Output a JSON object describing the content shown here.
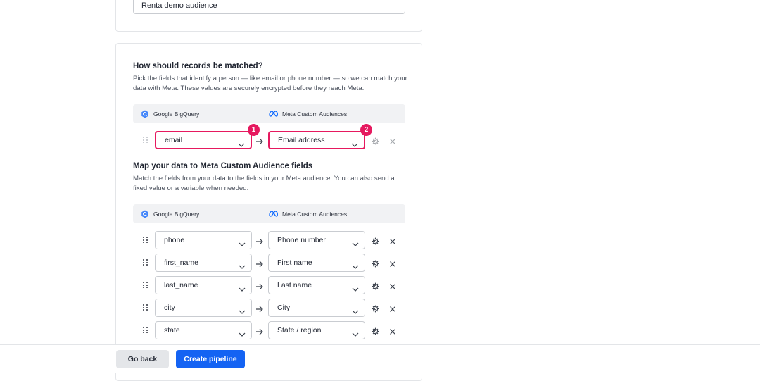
{
  "audience_name": {
    "value": "Renta demo audience"
  },
  "match_section": {
    "heading": "How should records be matched?",
    "description": "Pick the fields that identify a person — like email or phone number — so we can match your data with Meta. These values are securely encrypted before they reach Meta.",
    "source_label": "Google BigQuery",
    "destination_label": "Meta Custom Audiences",
    "row": {
      "source": "email",
      "destination": "Email address",
      "badge_source": "1",
      "badge_destination": "2"
    }
  },
  "map_section": {
    "heading": "Map your data to Meta Custom Audience fields",
    "description": "Match the fields from your data to the fields in your Meta audience. You can also send a fixed value or a variable when needed.",
    "source_label": "Google BigQuery",
    "destination_label": "Meta Custom Audiences",
    "rows": [
      {
        "source": "phone",
        "destination": "Phone number"
      },
      {
        "source": "first_name",
        "destination": "First name"
      },
      {
        "source": "last_name",
        "destination": "Last name"
      },
      {
        "source": "city",
        "destination": "City"
      },
      {
        "source": "state",
        "destination": "State / region"
      }
    ]
  },
  "footer": {
    "back_label": "Go back",
    "create_label": "Create pipeline"
  },
  "colors": {
    "highlight": "#e6195f",
    "primary": "#1463f3",
    "bigquery": "#4386fa",
    "meta": "#0866ff"
  },
  "icons": [
    "bigquery-icon",
    "meta-icon",
    "drag-handle-icon",
    "chevron-down-icon",
    "arrow-right-icon",
    "gear-icon",
    "close-icon"
  ]
}
